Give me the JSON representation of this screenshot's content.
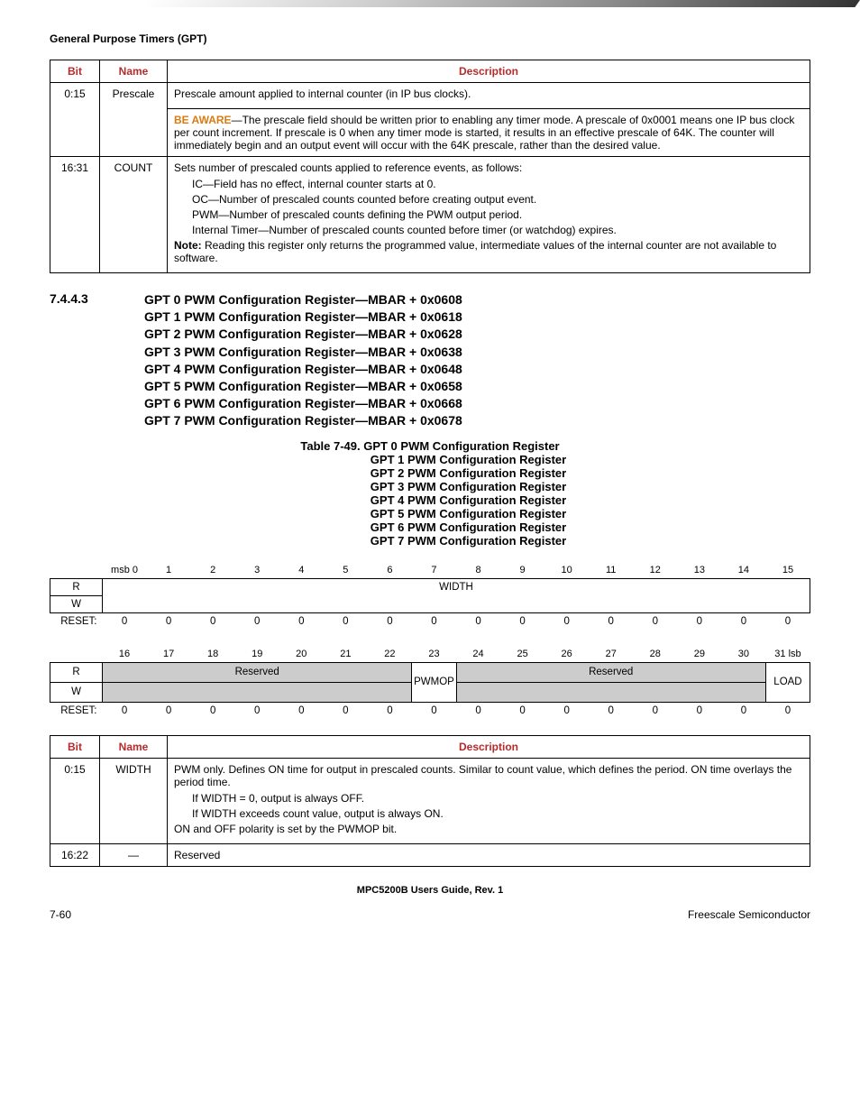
{
  "header": {
    "section_title": "General Purpose Timers (GPT)"
  },
  "table1": {
    "headers": {
      "bit": "Bit",
      "name": "Name",
      "desc": "Description"
    },
    "rows": [
      {
        "bit": "0:15",
        "name": "Prescale",
        "line1": "Prescale amount applied to internal counter (in IP bus clocks).",
        "aware_label": "BE AWARE",
        "aware_text": "—The prescale field should be written prior to enabling any timer mode. A prescale of 0x0001 means one IP bus clock per count increment. If prescale is 0 when any timer mode is started, it results in an effective prescale of 64K. The counter will immediately begin and an output event will occur with the 64K prescale, rather than the desired value."
      },
      {
        "bit": "16:31",
        "name": "COUNT",
        "line1": "Sets number of prescaled counts applied to reference events, as follows:",
        "ic": "IC—Field has no effect, internal counter starts at 0.",
        "oc": "OC—Number of prescaled counts counted before creating output event.",
        "pwm": "PWM—Number of prescaled counts defining the PWM output period.",
        "it": "Internal Timer—Number of prescaled counts counted before timer (or watchdog) expires.",
        "note_label": "Note:",
        "note_text": "  Reading this register only returns the programmed value, intermediate values of the internal counter are not available to software."
      }
    ]
  },
  "section": {
    "number": "7.4.4.3",
    "titles": [
      "GPT 0 PWM Configuration Register—MBAR + 0x0608",
      "GPT 1 PWM Configuration Register—MBAR + 0x0618",
      "GPT 2 PWM Configuration Register—MBAR + 0x0628",
      "GPT 3 PWM Configuration Register—MBAR + 0x0638",
      "GPT 4 PWM Configuration Register—MBAR + 0x0648",
      "GPT 5 PWM Configuration Register—MBAR + 0x0658",
      "GPT 6 PWM Configuration Register—MBAR + 0x0668",
      "GPT 7 PWM Configuration Register—MBAR + 0x0678"
    ]
  },
  "caption": {
    "line0": "Table 7-49. GPT 0 PWM Configuration Register",
    "subs": [
      "GPT 1 PWM Configuration Register",
      "GPT 2 PWM Configuration Register",
      "GPT 3 PWM Configuration Register",
      "GPT 4 PWM Configuration Register",
      "GPT 5 PWM Configuration Register",
      "GPT 6 PWM Configuration Register",
      "GPT 7 PWM Configuration Register"
    ]
  },
  "register": {
    "labels": {
      "r": "R",
      "w": "W",
      "reset": "RESET:"
    },
    "row1_bits": [
      "msb 0",
      "1",
      "2",
      "3",
      "4",
      "5",
      "6",
      "7",
      "8",
      "9",
      "10",
      "11",
      "12",
      "13",
      "14",
      "15"
    ],
    "row1_field": "WIDTH",
    "row1_reset": [
      "0",
      "0",
      "0",
      "0",
      "0",
      "0",
      "0",
      "0",
      "0",
      "0",
      "0",
      "0",
      "0",
      "0",
      "0",
      "0"
    ],
    "row2_bits": [
      "16",
      "17",
      "18",
      "19",
      "20",
      "21",
      "22",
      "23",
      "24",
      "25",
      "26",
      "27",
      "28",
      "29",
      "30",
      "31 lsb"
    ],
    "row2_fields": {
      "f1": "Reserved",
      "f2": "PWMOP",
      "f3": "Reserved",
      "f4": "LOAD"
    },
    "row2_reset": [
      "0",
      "0",
      "0",
      "0",
      "0",
      "0",
      "0",
      "0",
      "0",
      "0",
      "0",
      "0",
      "0",
      "0",
      "0",
      "0"
    ]
  },
  "table2": {
    "headers": {
      "bit": "Bit",
      "name": "Name",
      "desc": "Description"
    },
    "rows": [
      {
        "bit": "0:15",
        "name": "WIDTH",
        "line1": "PWM only. Defines ON time for output in prescaled counts. Similar to count value, which defines the period. ON time overlays the period time.",
        "l2": "If WIDTH = 0, output is always OFF.",
        "l3": "If WIDTH exceeds count value, output is always ON.",
        "l4": "ON and OFF polarity is set by the PWMOP bit."
      },
      {
        "bit": "16:22",
        "name": "—",
        "line1": "Reserved"
      }
    ]
  },
  "footer": {
    "center": "MPC5200B Users Guide, Rev. 1",
    "left": "7-60",
    "right": "Freescale Semiconductor"
  }
}
